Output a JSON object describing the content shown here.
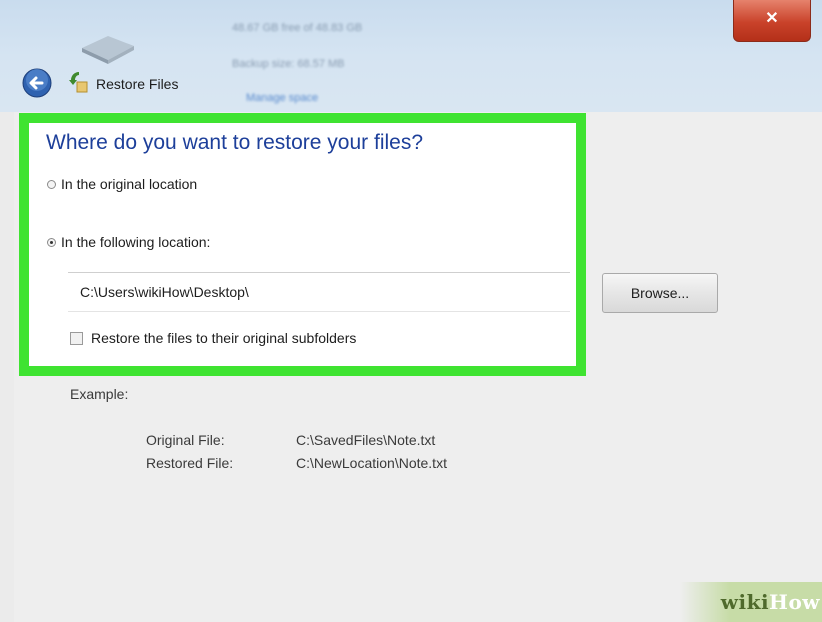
{
  "window": {
    "title": "Restore Files",
    "close_symbol": "✕",
    "background_info": {
      "free_space": "48.67 GB free of 48.83 GB",
      "backup_size": "Backup size: 68.57 MB",
      "manage_space": "Manage space"
    }
  },
  "icons": {
    "back": "back-arrow-icon",
    "restore": "restore-files-icon",
    "drive": "backup-drive-icon",
    "close": "close-icon"
  },
  "restore": {
    "question": "Where do you want to restore your files?",
    "options": [
      {
        "label": "In the original location",
        "selected": false
      },
      {
        "label": "In the following location:",
        "selected": true
      }
    ],
    "path_value": "C:\\Users\\wikiHow\\Desktop\\",
    "subfolders_label": "Restore the files to their original subfolders",
    "subfolders_checked": false,
    "browse_label": "Browse..."
  },
  "example": {
    "heading": "Example:",
    "original_label": "Original File:",
    "original_value": "C:\\SavedFiles\\Note.txt",
    "restored_label": "Restored File:",
    "restored_value": "C:\\NewLocation\\Note.txt"
  },
  "watermark": {
    "wiki": "wiki",
    "how": "How"
  },
  "colors": {
    "highlight": "#3fe331",
    "question": "#1d3f9a",
    "close": "#c9422a"
  }
}
